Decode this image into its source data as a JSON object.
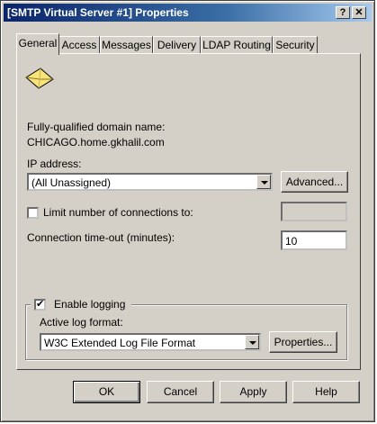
{
  "window": {
    "title": "[SMTP Virtual Server #1] Properties",
    "help_glyph": "?",
    "close_glyph": "✕"
  },
  "tabs": [
    {
      "label": "General",
      "active": true
    },
    {
      "label": "Access"
    },
    {
      "label": "Messages"
    },
    {
      "label": "Delivery"
    },
    {
      "label": "LDAP Routing"
    },
    {
      "label": "Security"
    }
  ],
  "general": {
    "icon": "envelope-icon",
    "fqdn_label": "Fully-qualified domain name:",
    "fqdn_value": "CHICAGO.home.gkhalil.com",
    "ip_label": "IP address:",
    "ip_value": "(All Unassigned)",
    "advanced_label": "Advanced...",
    "limit_label": "Limit number of connections to:",
    "limit_checked": false,
    "limit_value": "",
    "timeout_label": "Connection time-out (minutes):",
    "timeout_value": "10",
    "enable_logging_label": "Enable logging",
    "enable_logging_checked": true,
    "log_format_label": "Active log format:",
    "log_format_value": "W3C Extended Log File Format",
    "properties_label": "Properties...",
    "check_glyph": "✔"
  },
  "footer": {
    "ok": "OK",
    "cancel": "Cancel",
    "apply": "Apply",
    "help": "Help"
  }
}
